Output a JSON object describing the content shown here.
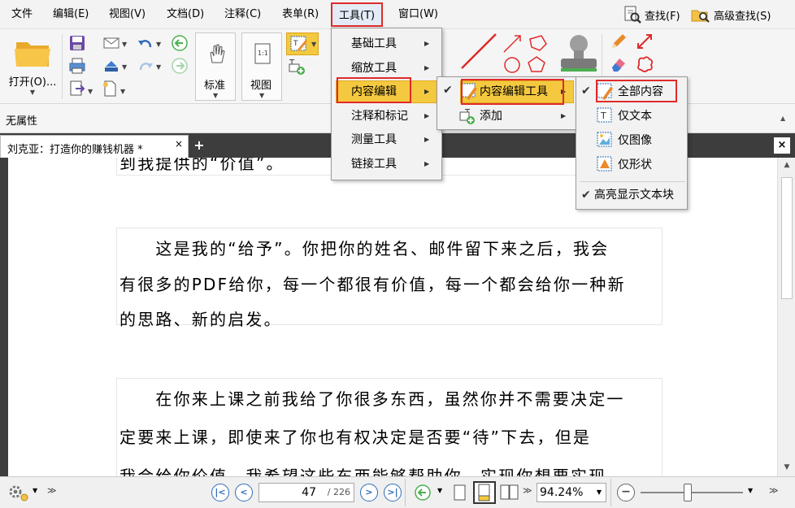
{
  "menubar": {
    "items": [
      "文件",
      "编辑(E)",
      "视图(V)",
      "文档(D)",
      "注释(C)",
      "表单(R)",
      "工具(T)",
      "窗口(W)"
    ],
    "find_label": "查找(F)",
    "advanced_find_label": "高级查找(S)"
  },
  "ribbon": {
    "open_label": "打开(O)...",
    "standard_label": "标准",
    "view_label": "视图"
  },
  "properties": {
    "label": "无属性"
  },
  "tab": {
    "title": "刘克亚：打造你的赚钱机器 *",
    "close_glyph": "×",
    "add_glyph": "+"
  },
  "tools_menu": {
    "items": [
      "基础工具",
      "缩放工具",
      "内容编辑",
      "注释和标记",
      "测量工具",
      "链接工具"
    ]
  },
  "content_edit_menu": {
    "items": [
      "内容编辑工具",
      "添加"
    ]
  },
  "content_tool_menu": {
    "items": [
      "全部内容",
      "仅文本",
      "仅图像",
      "仅形状"
    ],
    "highlight_label": "高亮显示文本块"
  },
  "document": {
    "top_fragment": "到我提供的“价值”。",
    "para1": [
      "　　这是我的“给予”。你把你的姓名、邮件留下来之后，我会",
      "有很多的PDF给你，每一个都很有价值，每一个都会给你一种新",
      "的思路、新的启发。"
    ],
    "para2": [
      "　　在你来上课之前我给了你很多东西，虽然你并不需要决定一",
      "定要来上课，即使来了你也有权决定是否要“待”下去，但是",
      "我会给你价值，我希望这些东西能够帮助你，实现你想要实现"
    ]
  },
  "status": {
    "current_page": "47",
    "total_pages": "/ 226",
    "zoom": "94.24%"
  },
  "colors": {
    "accent": "#2f6db7",
    "highlight": "#f5c93f",
    "annotation_red": "#e02a2a"
  }
}
